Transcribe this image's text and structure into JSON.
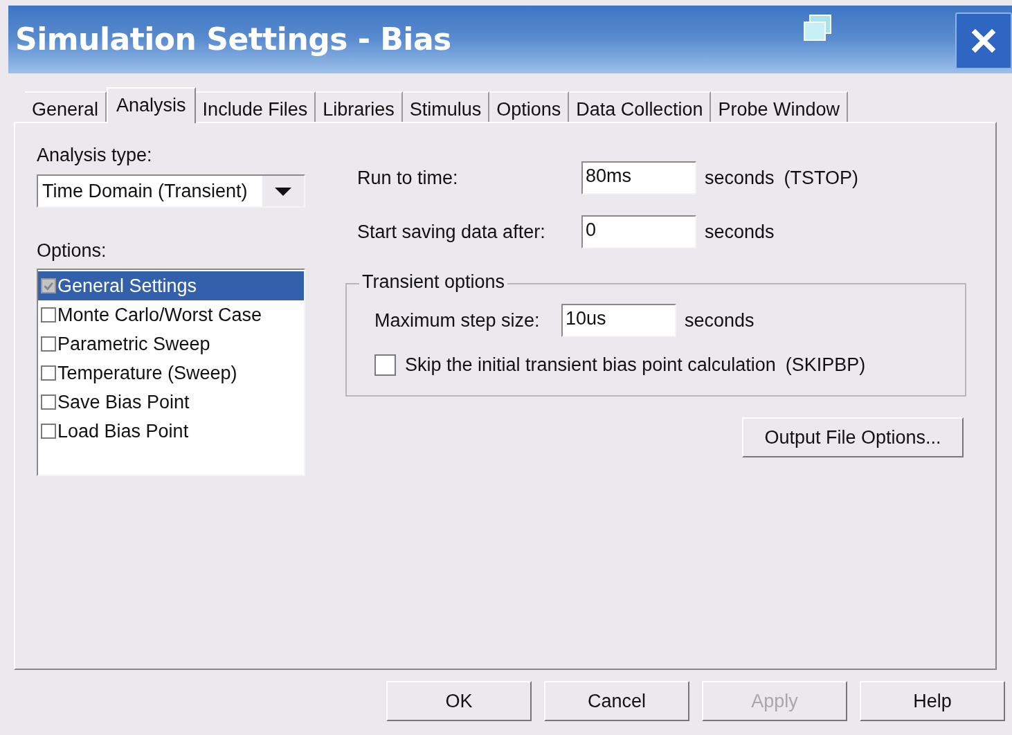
{
  "window": {
    "title": "Simulation Settings - Bias"
  },
  "tabs": [
    {
      "label": "General",
      "selected": false
    },
    {
      "label": "Analysis",
      "selected": true
    },
    {
      "label": "Include Files",
      "selected": false
    },
    {
      "label": "Libraries",
      "selected": false
    },
    {
      "label": "Stimulus",
      "selected": false
    },
    {
      "label": "Options",
      "selected": false
    },
    {
      "label": "Data Collection",
      "selected": false
    },
    {
      "label": "Probe Window",
      "selected": false
    }
  ],
  "analysis_type": {
    "label": "Analysis type:",
    "value": "Time Domain (Transient)"
  },
  "options": {
    "label": "Options:",
    "items": [
      {
        "label": "General Settings",
        "checked": true,
        "disabled": true,
        "selected": true
      },
      {
        "label": "Monte Carlo/Worst Case",
        "checked": false,
        "disabled": false,
        "selected": false
      },
      {
        "label": "Parametric Sweep",
        "checked": false,
        "disabled": false,
        "selected": false
      },
      {
        "label": "Temperature (Sweep)",
        "checked": false,
        "disabled": false,
        "selected": false
      },
      {
        "label": "Save Bias Point",
        "checked": false,
        "disabled": false,
        "selected": false
      },
      {
        "label": "Load Bias Point",
        "checked": false,
        "disabled": false,
        "selected": false
      }
    ]
  },
  "fields": [
    {
      "label": "Run to time:",
      "value": "80ms",
      "unit": "seconds",
      "note": "(TSTOP)"
    },
    {
      "label": "Start saving data after:",
      "value": "0",
      "unit": "seconds"
    }
  ],
  "transient_options": {
    "title": "Transient options",
    "max_step": {
      "label": "Maximum step size:",
      "value": "10us",
      "unit": "seconds"
    },
    "skip_bias": {
      "label": "Skip the initial transient bias point calculation",
      "note": "(SKIPBP)",
      "checked": false
    }
  },
  "output_file_button": "Output File Options...",
  "buttons": [
    {
      "label": "OK",
      "disabled": false
    },
    {
      "label": "Cancel",
      "disabled": false
    },
    {
      "label": "Apply",
      "disabled": true
    },
    {
      "label": "Help",
      "disabled": false
    }
  ]
}
